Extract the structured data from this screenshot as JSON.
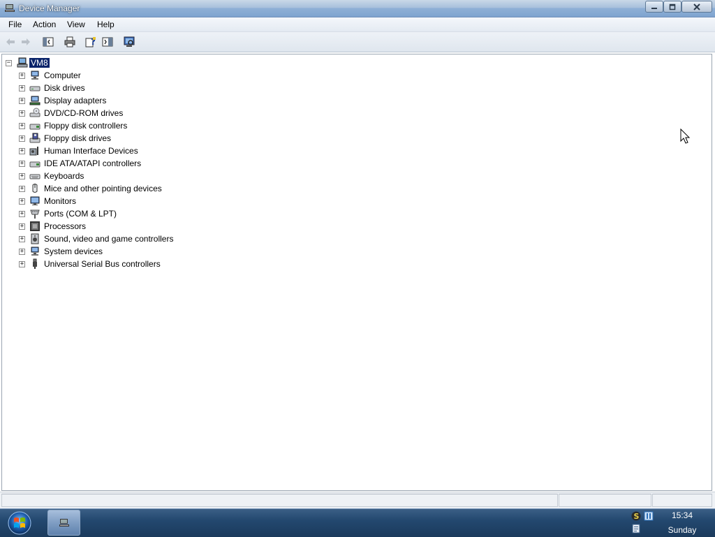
{
  "window": {
    "title": "Device Manager"
  },
  "menu": [
    "File",
    "Action",
    "View",
    "Help"
  ],
  "toolbar": {
    "icons": [
      "back-arrow-icon",
      "forward-arrow-icon",
      "show-hide-console-tree-icon",
      "print-icon",
      "help-icon",
      "properties-icon",
      "scan-hardware-icon"
    ]
  },
  "tree": {
    "root": "VM8",
    "items": [
      {
        "label": "Computer",
        "icon": "computer-icon"
      },
      {
        "label": "Disk drives",
        "icon": "disk-drive-icon"
      },
      {
        "label": "Display adapters",
        "icon": "display-adapter-icon"
      },
      {
        "label": "DVD/CD-ROM drives",
        "icon": "dvd-drive-icon"
      },
      {
        "label": "Floppy disk controllers",
        "icon": "floppy-controller-icon"
      },
      {
        "label": "Floppy disk drives",
        "icon": "floppy-drive-icon"
      },
      {
        "label": "Human Interface Devices",
        "icon": "hid-icon"
      },
      {
        "label": "IDE ATA/ATAPI controllers",
        "icon": "ide-controller-icon"
      },
      {
        "label": "Keyboards",
        "icon": "keyboard-icon"
      },
      {
        "label": "Mice and other pointing devices",
        "icon": "mouse-icon"
      },
      {
        "label": "Monitors",
        "icon": "monitor-icon"
      },
      {
        "label": "Ports (COM & LPT)",
        "icon": "port-icon"
      },
      {
        "label": "Processors",
        "icon": "processor-icon"
      },
      {
        "label": "Sound, video and game controllers",
        "icon": "sound-icon"
      },
      {
        "label": "System devices",
        "icon": "system-device-icon"
      },
      {
        "label": "Universal Serial Bus controllers",
        "icon": "usb-icon"
      }
    ]
  },
  "taskbar": {
    "clock_time": "15:34",
    "clock_day": "Sunday"
  },
  "colors": {
    "selection": "#0a246a",
    "taskbar": "#1b3a5c",
    "titlebar": "#8fb0d6"
  }
}
